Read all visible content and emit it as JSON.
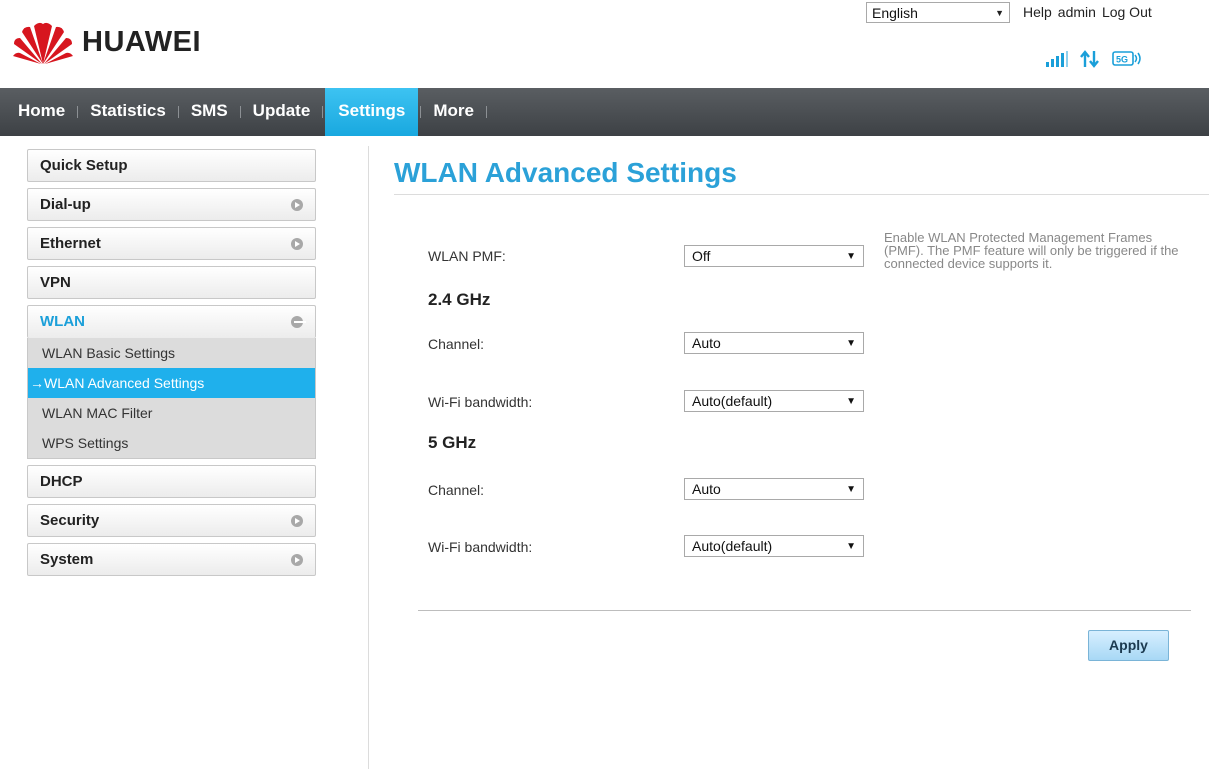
{
  "brand": {
    "name": "HUAWEI"
  },
  "topbar": {
    "language": "English",
    "links": [
      "Help",
      "admin",
      "Log Out"
    ],
    "status": {
      "signal_icon": "signal-bars-icon",
      "data_icon": "data-transfer-icon",
      "wifi_badge": "5G"
    }
  },
  "nav": {
    "items": [
      "Home",
      "Statistics",
      "SMS",
      "Update",
      "Settings",
      "More"
    ],
    "active": "Settings"
  },
  "sidebar": {
    "items": [
      {
        "label": "Quick Setup"
      },
      {
        "label": "Dial-up"
      },
      {
        "label": "Ethernet"
      },
      {
        "label": "VPN"
      },
      {
        "label": "WLAN",
        "expanded": true,
        "children": [
          "WLAN Basic Settings",
          "WLAN Advanced Settings",
          "WLAN MAC Filter",
          "WPS Settings"
        ]
      },
      {
        "label": "DHCP"
      },
      {
        "label": "Security"
      },
      {
        "label": "System"
      }
    ],
    "active_child": "WLAN Advanced Settings"
  },
  "main": {
    "title": "WLAN Advanced Settings",
    "pmf": {
      "label": "WLAN PMF:",
      "value": "Off",
      "help": "Enable WLAN Protected Management Frames (PMF). The PMF feature will only be triggered if the connected device supports it."
    },
    "band24": {
      "heading": "2.4 GHz",
      "channel_label": "Channel:",
      "channel_value": "Auto",
      "bandwidth_label": "Wi-Fi bandwidth:",
      "bandwidth_value": "Auto(default)"
    },
    "band5": {
      "heading": "5 GHz",
      "channel_label": "Channel:",
      "channel_value": "Auto",
      "bandwidth_label": "Wi-Fi bandwidth:",
      "bandwidth_value": "Auto(default)"
    },
    "apply_label": "Apply"
  },
  "colors": {
    "accent": "#1fb0ec",
    "title": "#2ba1d8",
    "nav_bg": "#44484c"
  }
}
